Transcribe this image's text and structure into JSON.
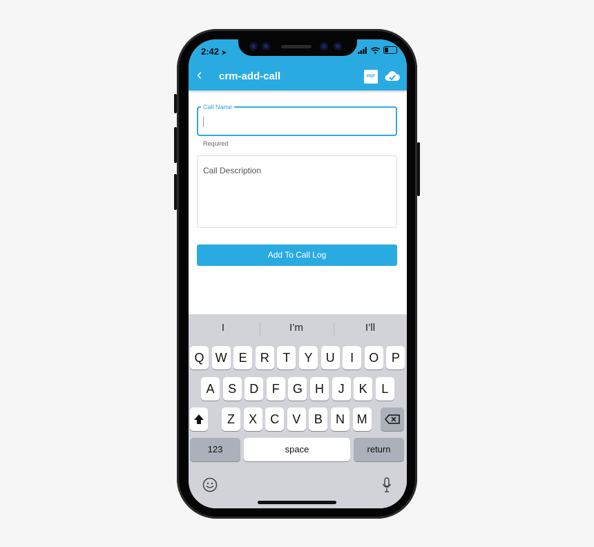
{
  "status": {
    "time": "2:42",
    "location_arrow": "➤"
  },
  "appbar": {
    "back_icon": "‹",
    "title": "crm-add-call",
    "pdf_label": "PDF"
  },
  "form": {
    "call_name_label": "Call Name",
    "call_name_value": "",
    "call_name_helper": "Required",
    "description_placeholder": "Call Description",
    "submit_label": "Add To Call Log"
  },
  "keyboard": {
    "suggestions": [
      "I",
      "I’m",
      "I’ll"
    ],
    "row1": [
      "Q",
      "W",
      "E",
      "R",
      "T",
      "Y",
      "U",
      "I",
      "O",
      "P"
    ],
    "row2": [
      "A",
      "S",
      "D",
      "F",
      "G",
      "H",
      "J",
      "K",
      "L"
    ],
    "row3": [
      "Z",
      "X",
      "C",
      "V",
      "B",
      "N",
      "M"
    ],
    "numbers_label": "123",
    "space_label": "space",
    "return_label": "return"
  },
  "colors": {
    "accent": "#29abe2",
    "keyboard_bg": "#d1d3d9"
  },
  "icons": [
    "back-chevron-icon",
    "pdf-icon",
    "cloud-check-icon",
    "shift-icon",
    "backspace-icon",
    "emoji-icon",
    "microphone-icon",
    "signal-icon",
    "wifi-icon",
    "battery-icon"
  ]
}
